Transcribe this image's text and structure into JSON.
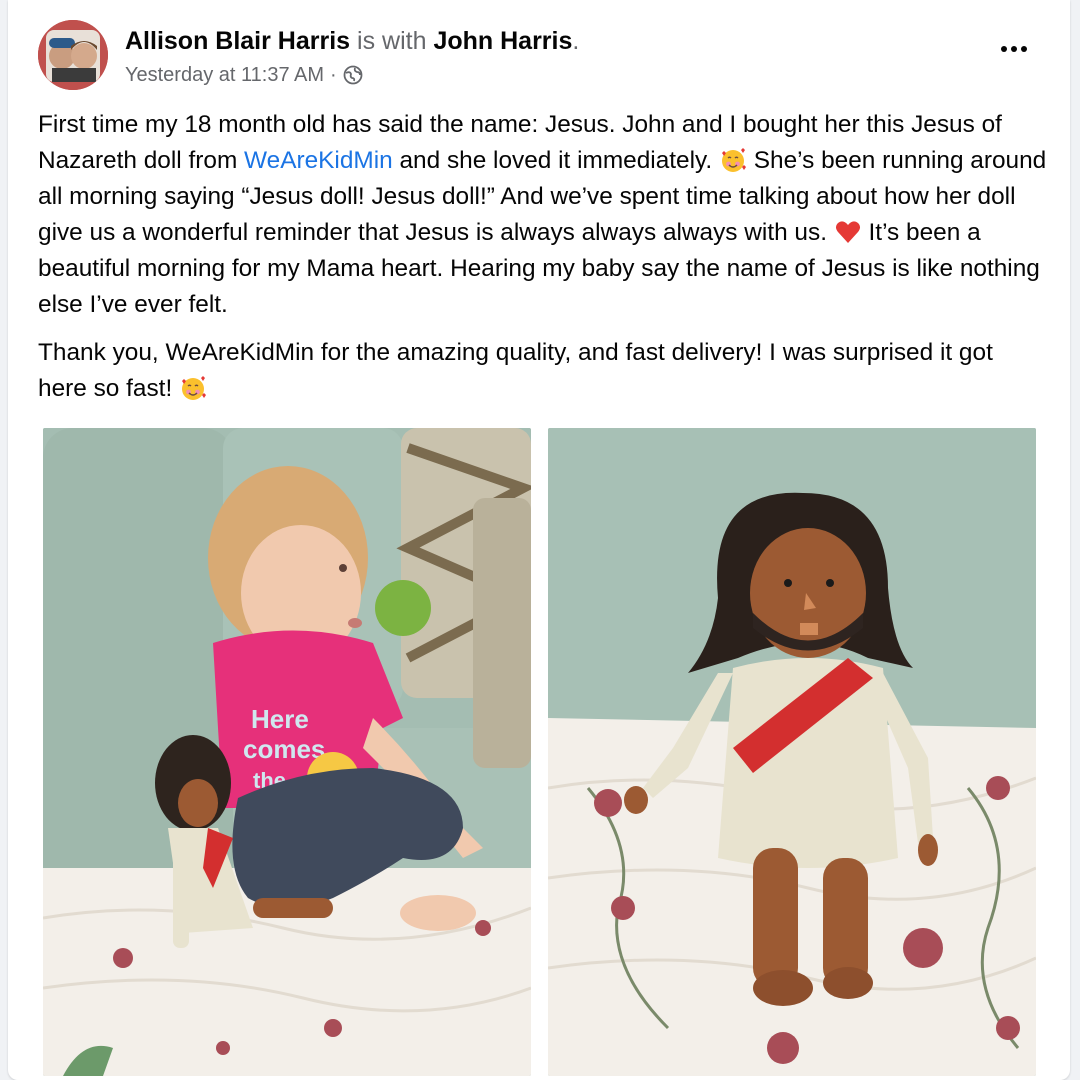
{
  "post": {
    "author": "Allison Blair Harris",
    "with_text": "is with",
    "tagged": "John Harris",
    "tagged_suffix": ".",
    "timestamp": "Yesterday at 11:37 AM",
    "separator": "·",
    "privacy_icon": "globe-icon",
    "more_icon": "more-options-icon",
    "paragraph1": {
      "part1": "First time my 18 month old has said the name: Jesus.  John and I bought her this Jesus of Nazareth doll from ",
      "link": "WeAreKidMin",
      "part2": " and she loved it immediately. ",
      "emoji1": "smiling-face-with-hearts",
      "part3": " She’s been running around all morning saying “Jesus doll!  Jesus doll!”  And we’ve spent time talking about how her doll give us a wonderful reminder that Jesus is always always always with us. ",
      "emoji2": "red-heart",
      "part4": " It’s been a beautiful morning for my Mama heart.  Hearing my baby say the name of Jesus is like nothing else I’ve ever felt."
    },
    "paragraph2": {
      "text": "Thank you, WeAreKidMin for the amazing quality, and fast delivery!  I was surprised it got here so fast! ",
      "emoji": "smiling-face-with-hearts"
    },
    "photos": [
      {
        "shirt_text_1": "Here",
        "shirt_text_2": "comes",
        "shirt_text_3": "the"
      },
      {}
    ]
  },
  "colors": {
    "link": "#1b74e4",
    "secondary_text": "#65676b",
    "card_bg": "#ffffff"
  }
}
